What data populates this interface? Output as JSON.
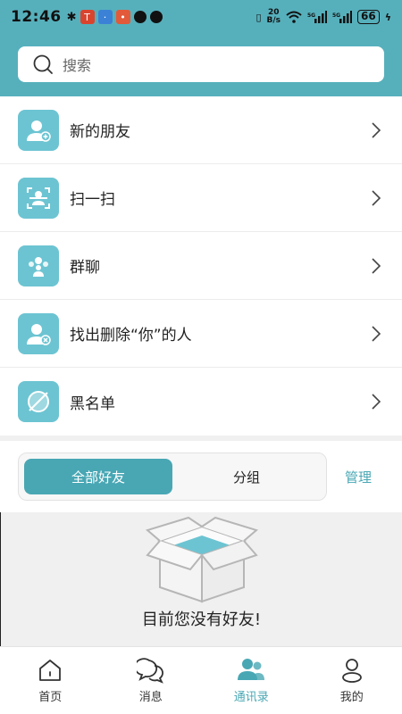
{
  "status_bar": {
    "time": "12:46",
    "net_speed_top": "20",
    "net_speed_bottom": "B/s",
    "battery": "66"
  },
  "search": {
    "placeholder": "搜索"
  },
  "menu": [
    {
      "label": "新的朋友",
      "icon": "new-friend-icon"
    },
    {
      "label": "扫一扫",
      "icon": "scan-icon"
    },
    {
      "label": "群聊",
      "icon": "group-chat-icon"
    },
    {
      "label": "找出删除“你”的人",
      "icon": "find-deleted-icon"
    },
    {
      "label": "黑名单",
      "icon": "blacklist-icon"
    }
  ],
  "segment": {
    "all_friends": "全部好友",
    "groups": "分组",
    "manage": "管理"
  },
  "empty": {
    "message": "目前您没有好友!"
  },
  "tabbar": [
    {
      "label": "首页",
      "icon": "home-icon"
    },
    {
      "label": "消息",
      "icon": "message-icon"
    },
    {
      "label": "通讯录",
      "icon": "contacts-icon"
    },
    {
      "label": "我的",
      "icon": "profile-icon"
    }
  ],
  "colors": {
    "accent": "#49a7b4",
    "header": "#56b0bc",
    "icon_bg": "#6cc4d2"
  }
}
